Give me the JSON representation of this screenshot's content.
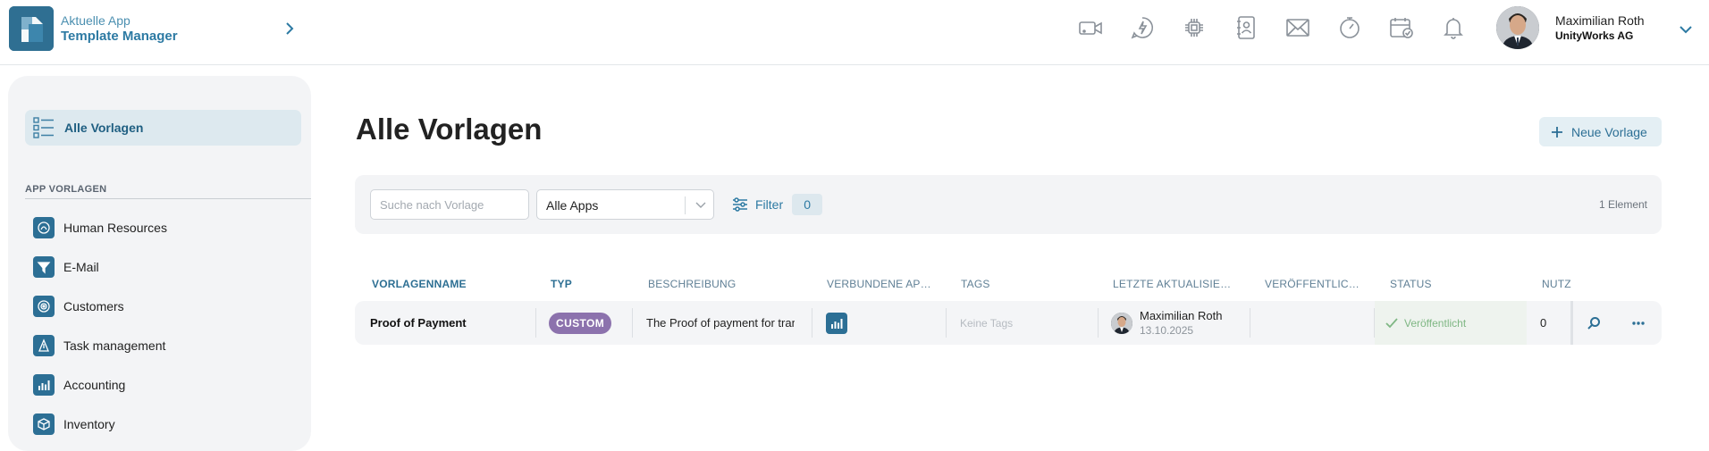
{
  "header": {
    "context_label": "Aktuelle App",
    "app_name": "Template Manager",
    "icons": [
      "video-call-icon",
      "chat-bolt-icon",
      "chip-icon",
      "contacts-book-icon",
      "mail-icon",
      "timer-icon",
      "calendar-check-icon",
      "bell-icon"
    ],
    "user": {
      "name": "Maximilian Roth",
      "company": "UnityWorks AG"
    }
  },
  "sidebar": {
    "active_item": "Alle Vorlagen",
    "section_title": "APP VORLAGEN",
    "apps": [
      {
        "label": "Human Resources",
        "icon": "hr-app-icon"
      },
      {
        "label": "E-Mail",
        "icon": "email-app-icon"
      },
      {
        "label": "Customers",
        "icon": "customers-app-icon"
      },
      {
        "label": "Task management",
        "icon": "task-app-icon"
      },
      {
        "label": "Accounting",
        "icon": "accounting-app-icon"
      },
      {
        "label": "Inventory",
        "icon": "inventory-app-icon"
      }
    ]
  },
  "main": {
    "title": "Alle Vorlagen",
    "new_button": "Neue Vorlage",
    "search_placeholder": "Suche nach Vorlage",
    "apps_filter_value": "Alle Apps",
    "filter_label": "Filter",
    "filter_count": "0",
    "element_count": "1 Element"
  },
  "table": {
    "columns": [
      "VORLAGENNAME",
      "TYP",
      "BESCHREIBUNG",
      "VERBUNDENE AP…",
      "TAGS",
      "LETZTE AKTUALISIER…",
      "VERÖFFENTLIC…",
      "STATUS",
      "NUTZ"
    ],
    "rows": [
      {
        "name": "Proof of Payment",
        "type": "CUSTOM",
        "description": "The Proof of payment for tran",
        "connected_app_icon": "accounting-app-icon",
        "tags": "Keine Tags",
        "updated_by": "Maximilian Roth",
        "updated_date": "13.10.2025",
        "published": "",
        "status": "Veröffentlicht",
        "usage": "0"
      }
    ]
  },
  "colors": {
    "accent": "#2d7aa3",
    "app_icon_bg": "#2c6f95",
    "custom_badge": "#8c72ad",
    "status_published": "#7fb784"
  }
}
